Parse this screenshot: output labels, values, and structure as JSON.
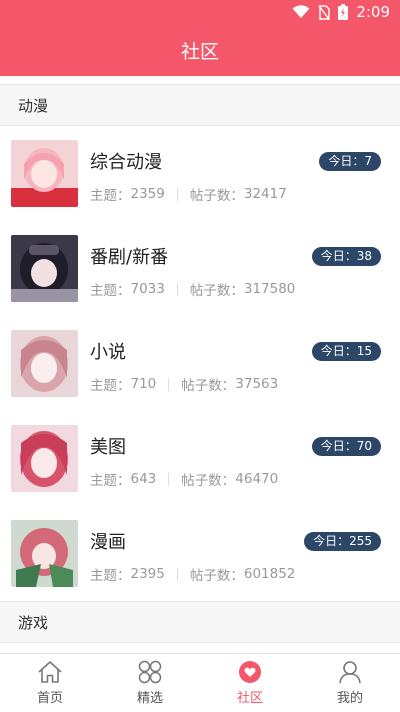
{
  "status_bar": {
    "time": "2:09"
  },
  "header": {
    "title": "社区"
  },
  "sections": [
    {
      "title": "动漫",
      "items": [
        {
          "name": "综合动漫",
          "topics_label": "主题：",
          "topics": "2359",
          "posts_label": "帖子数：",
          "posts": "32417",
          "today": "今日：7"
        },
        {
          "name": "番剧/新番",
          "topics_label": "主题：",
          "topics": "7033",
          "posts_label": "帖子数：",
          "posts": "317580",
          "today": "今日：38"
        },
        {
          "name": "小说",
          "topics_label": "主题：",
          "topics": "710",
          "posts_label": "帖子数：",
          "posts": "37563",
          "today": "今日：15"
        },
        {
          "name": "美图",
          "topics_label": "主题：",
          "topics": "643",
          "posts_label": "帖子数：",
          "posts": "46470",
          "today": "今日：70"
        },
        {
          "name": "漫画",
          "topics_label": "主题：",
          "topics": "2395",
          "posts_label": "帖子数：",
          "posts": "601852",
          "today": "今日：255"
        }
      ]
    },
    {
      "title": "游戏"
    }
  ],
  "tabs": [
    {
      "label": "首页",
      "icon": "home-icon"
    },
    {
      "label": "精选",
      "icon": "grid-icon"
    },
    {
      "label": "社区",
      "icon": "community-icon",
      "active": true
    },
    {
      "label": "我的",
      "icon": "user-icon"
    }
  ],
  "colors": {
    "accent": "#f4566a",
    "badge": "#2c4668"
  }
}
